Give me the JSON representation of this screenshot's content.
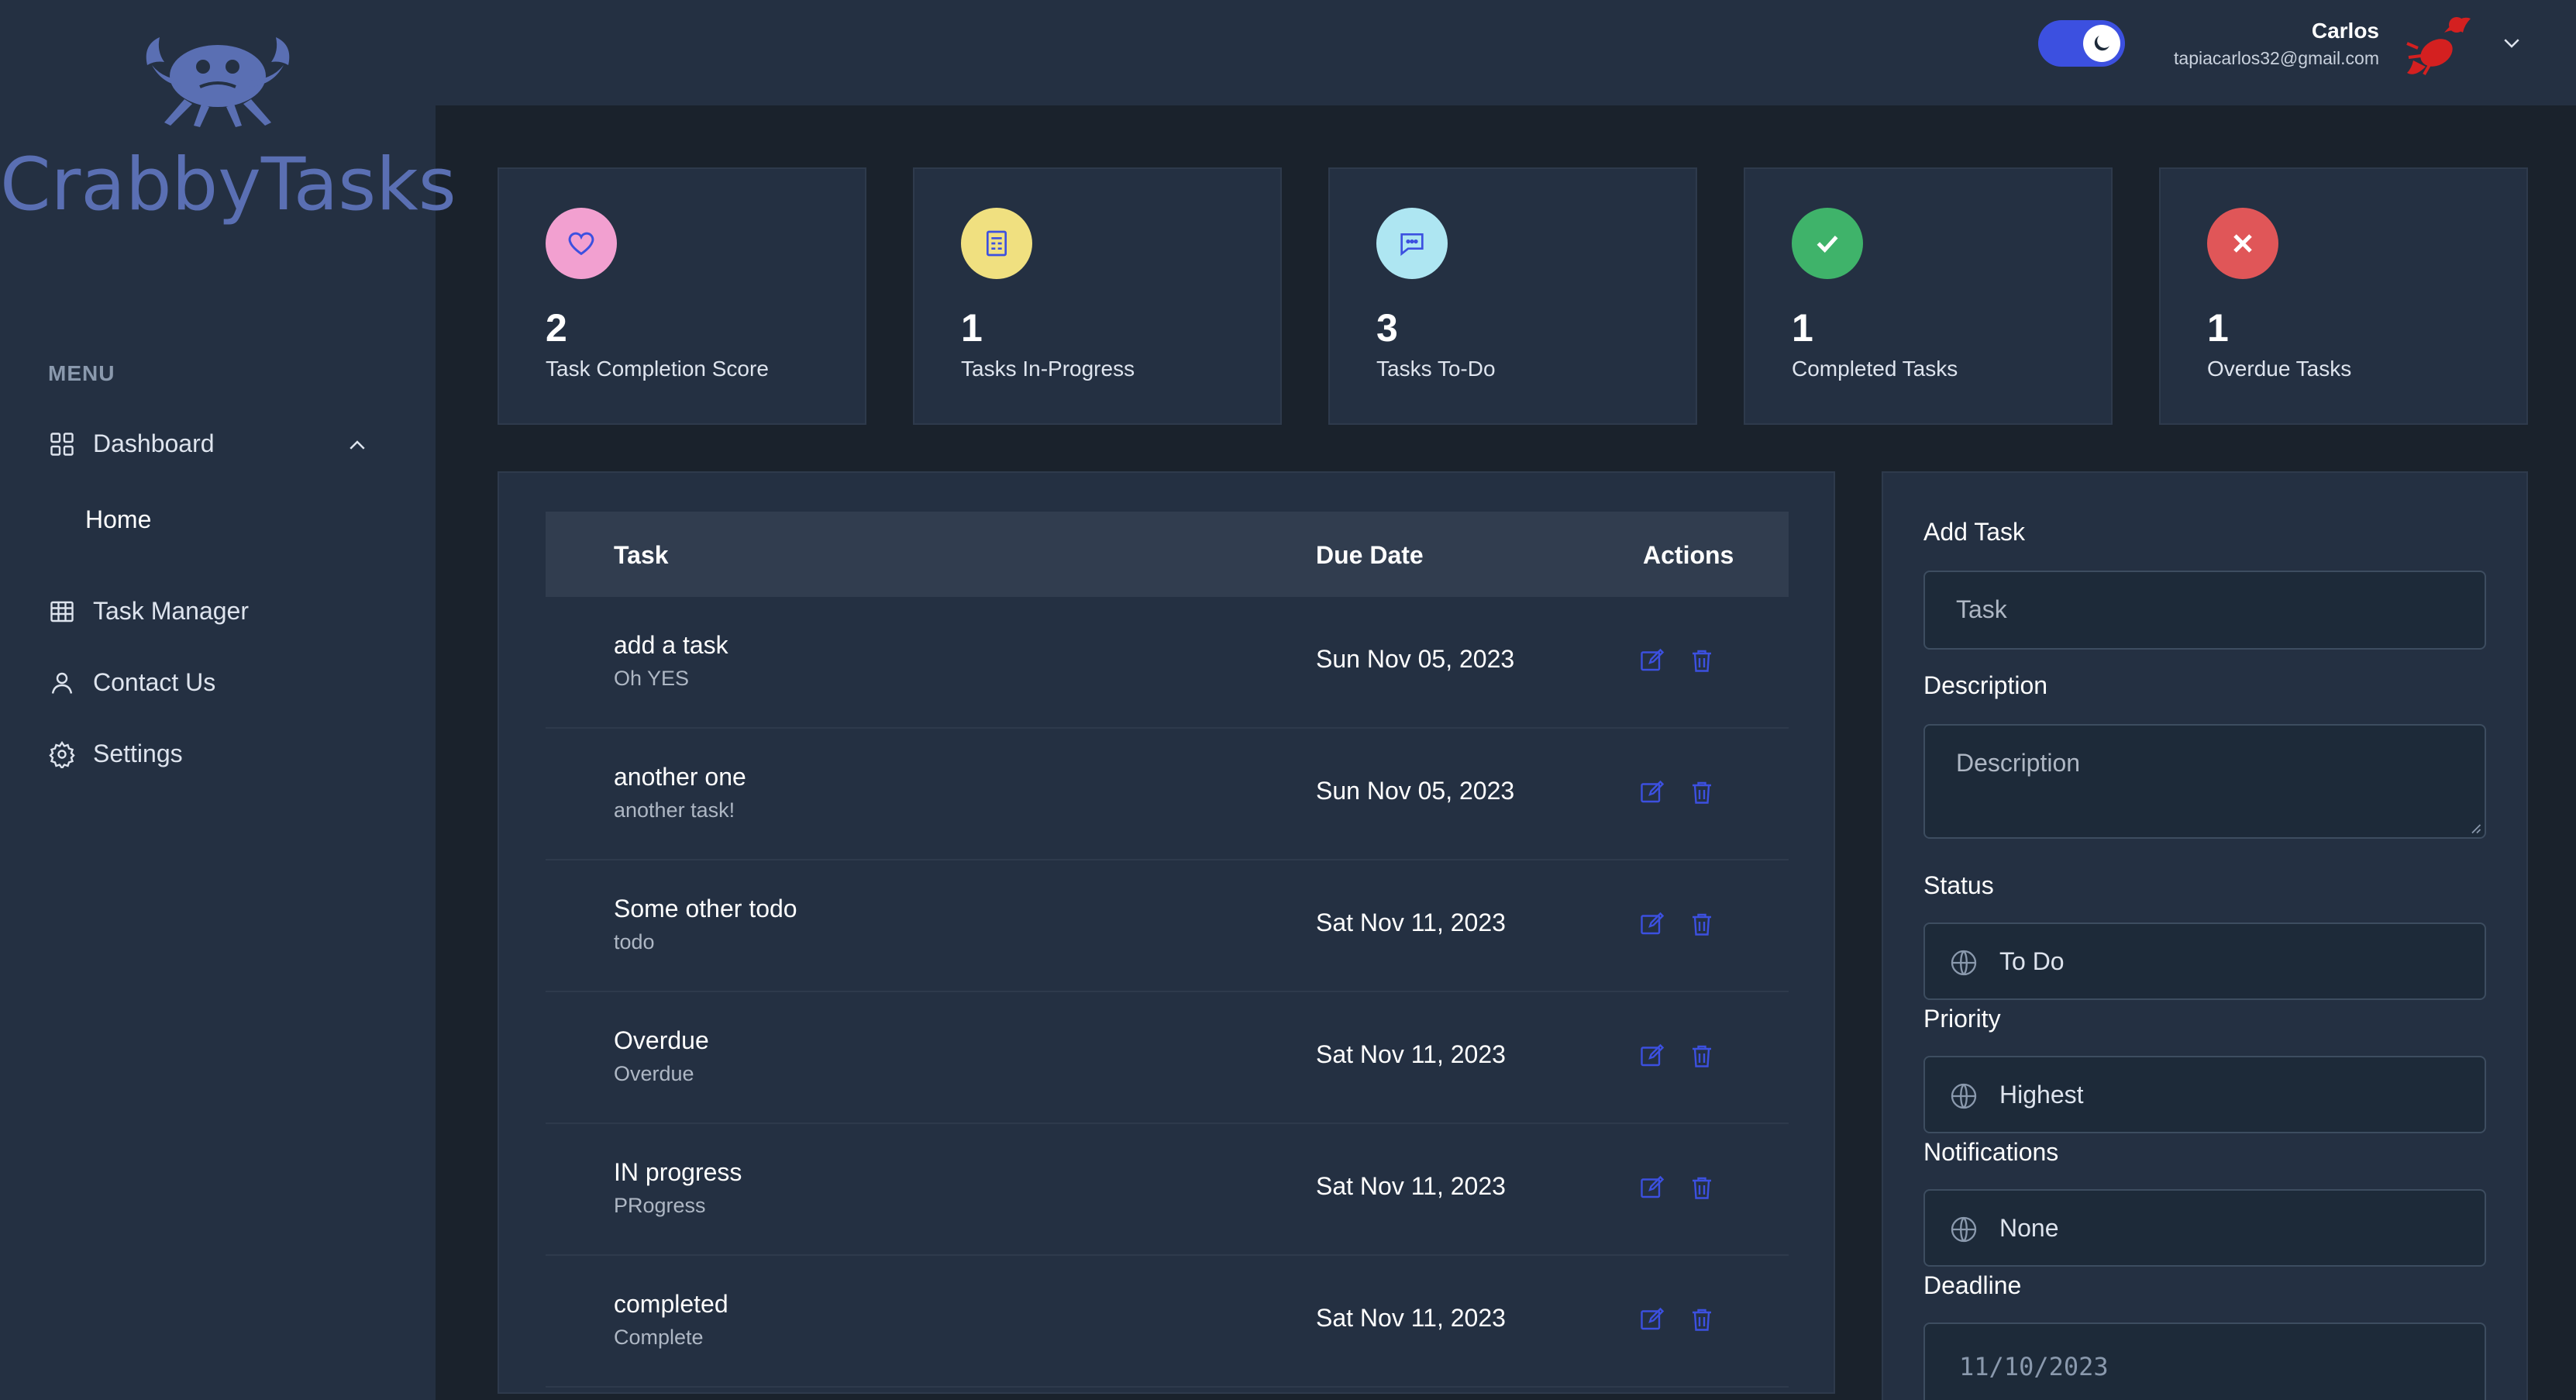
{
  "brand": {
    "name": "CrabbyTasks"
  },
  "sidebar": {
    "menu_label": "MENU",
    "items": [
      {
        "label": "Dashboard",
        "icon": "grid-icon",
        "expanded": true
      },
      {
        "label": "Home"
      },
      {
        "label": "Task Manager",
        "icon": "calendar-table-icon"
      },
      {
        "label": "Contact Us",
        "icon": "user-icon"
      },
      {
        "label": "Settings",
        "icon": "gear-icon"
      }
    ]
  },
  "header": {
    "dark_mode": true,
    "user": {
      "name": "Carlos",
      "email": "tapiacarlos32@gmail.com"
    }
  },
  "stats": [
    {
      "value": "2",
      "label": "Task Completion Score",
      "icon": "heart-icon",
      "color": "#f2a0d0"
    },
    {
      "value": "1",
      "label": "Tasks In-Progress",
      "icon": "clipboard-icon",
      "color": "#f0e080"
    },
    {
      "value": "3",
      "label": "Tasks To-Do",
      "icon": "chat-icon",
      "color": "#aee6f2"
    },
    {
      "value": "1",
      "label": "Completed Tasks",
      "icon": "check-icon",
      "color": "#3fb36a"
    },
    {
      "value": "1",
      "label": "Overdue Tasks",
      "icon": "x-icon",
      "color": "#e05658"
    }
  ],
  "table": {
    "headers": {
      "task": "Task",
      "due": "Due Date",
      "actions": "Actions"
    },
    "rows": [
      {
        "title": "add a task",
        "desc": "Oh YES",
        "due": "Sun Nov 05, 2023"
      },
      {
        "title": "another one",
        "desc": "another task!",
        "due": "Sun Nov 05, 2023"
      },
      {
        "title": "Some other todo",
        "desc": "todo",
        "due": "Sat Nov 11, 2023"
      },
      {
        "title": "Overdue",
        "desc": "Overdue",
        "due": "Sat Nov 11, 2023"
      },
      {
        "title": "IN progress",
        "desc": "PRogress",
        "due": "Sat Nov 11, 2023"
      },
      {
        "title": "completed",
        "desc": "Complete",
        "due": "Sat Nov 11, 2023"
      }
    ]
  },
  "form": {
    "title": "Add Task",
    "task_placeholder": "Task",
    "description_label": "Description",
    "description_placeholder": "Description",
    "status_label": "Status",
    "status_value": "To Do",
    "priority_label": "Priority",
    "priority_value": "Highest",
    "notifications_label": "Notifications",
    "notifications_value": "None",
    "deadline_label": "Deadline",
    "deadline_value": "11/10/2023"
  },
  "colors": {
    "accent": "#3c50e0",
    "brand": "#5a6fb3",
    "action_icon": "#3c50e0"
  }
}
